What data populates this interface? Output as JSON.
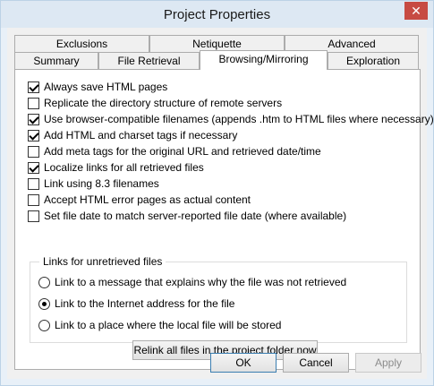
{
  "window": {
    "title": "Project Properties",
    "close_glyph": "✕"
  },
  "tabs": {
    "row1": [
      {
        "label": "Exclusions"
      },
      {
        "label": "Netiquette"
      },
      {
        "label": "Advanced"
      }
    ],
    "row2": [
      {
        "label": "Summary"
      },
      {
        "label": "File Retrieval"
      },
      {
        "label": "Browsing/Mirroring",
        "active": true
      },
      {
        "label": "Exploration"
      }
    ]
  },
  "options": [
    {
      "label": "Always save HTML pages",
      "checked": true
    },
    {
      "label": "Replicate the directory structure of remote servers",
      "checked": false
    },
    {
      "label": "Use browser-compatible filenames (appends .htm to HTML files where necessary)",
      "checked": true
    },
    {
      "label": "Add HTML and charset tags if necessary",
      "checked": true
    },
    {
      "label": "Add meta tags for the original URL and retrieved date/time",
      "checked": false
    },
    {
      "label": "Localize links for all retrieved files",
      "checked": true
    },
    {
      "label": "Link using 8.3 filenames",
      "checked": false
    },
    {
      "label": "Accept HTML error pages as actual content",
      "checked": false
    },
    {
      "label": "Set file date to match server-reported file date (where available)",
      "checked": false
    }
  ],
  "unretrieved": {
    "legend": "Links for unretrieved files",
    "choices": [
      {
        "label": "Link to a message that explains why the file was not retrieved",
        "selected": false
      },
      {
        "label": "Link to the Internet address for the file",
        "selected": true
      },
      {
        "label": "Link to a place where the local file will be stored",
        "selected": false
      }
    ]
  },
  "relink_button": "Relink all files in the project folder now",
  "footer": {
    "ok": "OK",
    "cancel": "Cancel",
    "apply": "Apply"
  },
  "colors": {
    "close_button": "#c74b43",
    "default_button_border": "#3c7fb1"
  }
}
